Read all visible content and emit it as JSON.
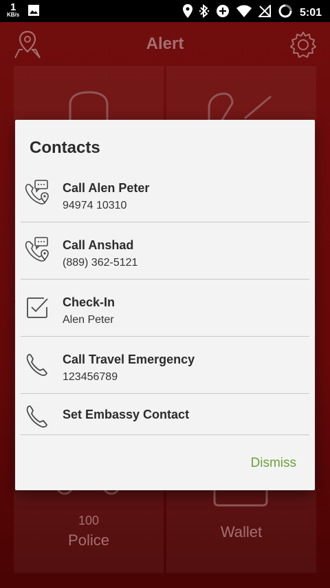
{
  "status_bar": {
    "speed_value": "1",
    "speed_unit": "KB/s",
    "time": "5:01",
    "icons": [
      "image-icon",
      "location-icon",
      "bluetooth-icon",
      "data-saver-icon",
      "wifi-icon",
      "no-sim-icon",
      "battery-icon"
    ]
  },
  "header": {
    "title": "Alert",
    "left_icon": "map-pin-icon",
    "right_icon": "gear-icon"
  },
  "tiles": {
    "police": {
      "number": "100",
      "label": "Police"
    },
    "wallet": {
      "label": "Wallet"
    }
  },
  "dialog": {
    "title": "Contacts",
    "items": [
      {
        "icon": "call-message-icon",
        "title": "Call Alen Peter",
        "subtitle": "94974 10310"
      },
      {
        "icon": "call-message-icon",
        "title": "Call Anshad",
        "subtitle": "(889) 362-5121"
      },
      {
        "icon": "checkbox-icon",
        "title": "Check-In",
        "subtitle": "Alen Peter"
      },
      {
        "icon": "phone-icon",
        "title": "Call Travel Emergency",
        "subtitle": "123456789"
      },
      {
        "icon": "phone-icon",
        "title": "Set Embassy Contact"
      }
    ],
    "dismiss_label": "Dismiss"
  },
  "colors": {
    "background": "#7c0c0c",
    "dialog": "#f3f3f4",
    "accent": "#6aa33a"
  }
}
